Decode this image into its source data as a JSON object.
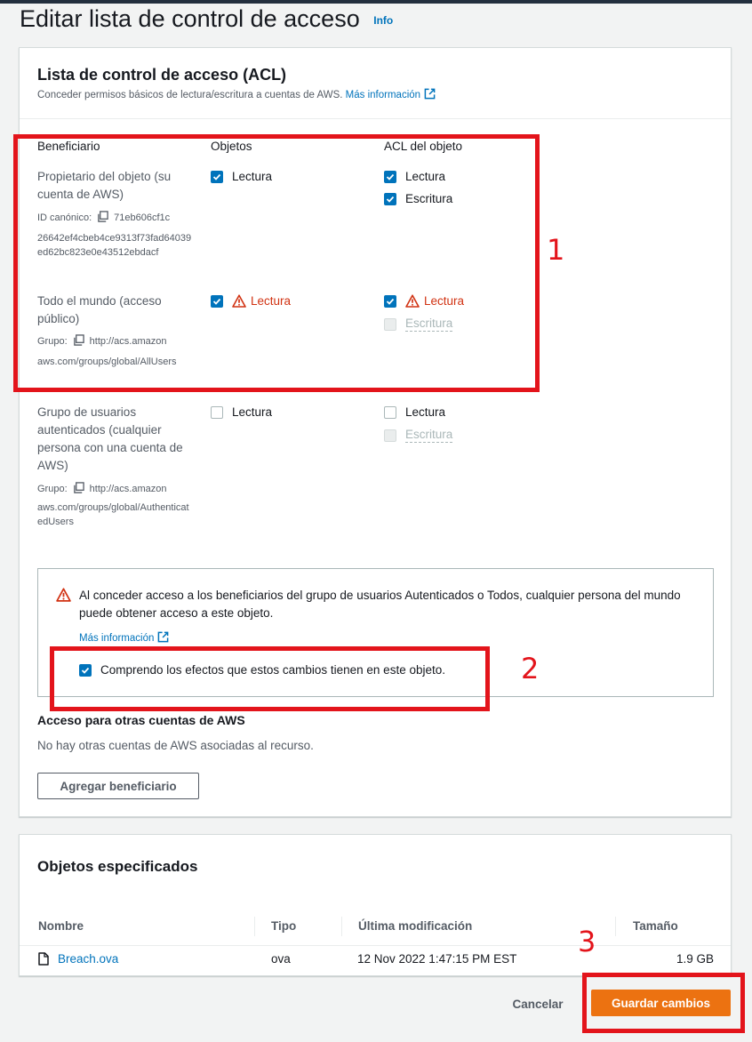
{
  "page": {
    "title": "Editar lista de control de acceso",
    "info_link": "Info"
  },
  "acl": {
    "title": "Lista de control de acceso (ACL)",
    "description": "Conceder permisos básicos de lectura/escritura a cuentas de AWS.",
    "more_info": "Más información",
    "columns": {
      "grantee": "Beneficiario",
      "objects": "Objetos",
      "object_acl": "ACL del objeto"
    },
    "owner": {
      "name": "Propietario del objeto (su cuenta de AWS)",
      "id_label": "ID canónico:",
      "id_value": "71eb606cf1c",
      "id_rest": "26642ef4cbeb4ce9313f73fad64039ed62bc823e0e43512ebdacf",
      "objects_read": "Lectura",
      "acl_read": "Lectura",
      "acl_write": "Escritura"
    },
    "everyone": {
      "name": "Todo el mundo (acceso público)",
      "group_label": "Grupo:",
      "group_url_head": "http://acs.amazon",
      "group_url_rest": "aws.com/groups/global/AllUsers",
      "objects_read": "Lectura",
      "acl_read": "Lectura",
      "acl_write": "Escritura"
    },
    "authenticated": {
      "name": "Grupo de usuarios autenticados (cualquier persona con una cuenta de AWS)",
      "group_label": "Grupo:",
      "group_url_head": "http://acs.amazon",
      "group_url_rest": "aws.com/groups/global/AuthenticatedUsers",
      "objects_read": "Lectura",
      "acl_read": "Lectura",
      "acl_write": "Escritura"
    },
    "warning": {
      "text": "Al conceder acceso a los beneficiarios del grupo de usuarios Autenticados o Todos, cualquier persona del mundo puede obtener acceso a este objeto.",
      "more_info": "Más información",
      "acknowledge": "Comprendo los efectos que estos cambios tienen en este objeto."
    },
    "other_accounts": {
      "title": "Acceso para otras cuentas de AWS",
      "empty": "No hay otras cuentas de AWS asociadas al recurso.",
      "add_button": "Agregar beneficiario"
    }
  },
  "objects": {
    "title": "Objetos especificados",
    "columns": [
      "Nombre",
      "Tipo",
      "Última modificación",
      "Tamaño"
    ],
    "rows": [
      {
        "name": "Breach.ova",
        "type": "ova",
        "modified": "12 Nov 2022 1:47:15 PM EST",
        "size": "1.9 GB"
      }
    ]
  },
  "footer": {
    "cancel": "Cancelar",
    "save": "Guardar cambios"
  },
  "annotations": [
    "1",
    "2",
    "3"
  ],
  "colors": {
    "accent": "#0073bb",
    "primary_button": "#ec7211",
    "warning": "#d13212",
    "annotation": "#e3141b"
  }
}
